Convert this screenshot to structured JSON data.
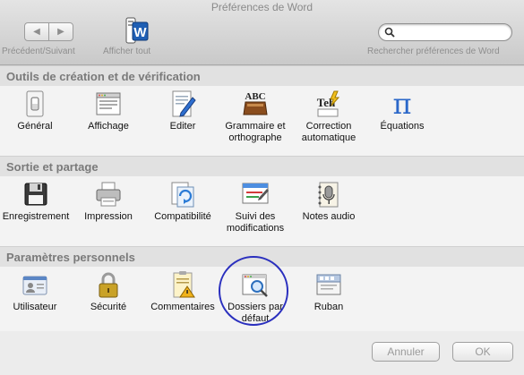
{
  "window": {
    "title": "Préférences de Word"
  },
  "toolbar": {
    "nav_label": "Précédent/Suivant",
    "show_all_label": "Afficher tout",
    "search_placeholder": "Rechercher préférences de Word"
  },
  "sections": [
    {
      "title": "Outils de création et de vérification",
      "items": [
        {
          "label": "Général",
          "icon": "light-switch-icon"
        },
        {
          "label": "Affichage",
          "icon": "window-view-icon"
        },
        {
          "label": "Editer",
          "icon": "document-pencil-icon"
        },
        {
          "label": "Grammaire et orthographe",
          "icon": "abc-book-icon"
        },
        {
          "label": "Correction automatique",
          "icon": "autocorrect-icon"
        },
        {
          "label": "Équations",
          "icon": "pi-icon"
        }
      ]
    },
    {
      "title": "Sortie et partage",
      "items": [
        {
          "label": "Enregistrement",
          "icon": "floppy-disk-icon"
        },
        {
          "label": "Impression",
          "icon": "printer-icon"
        },
        {
          "label": "Compatibilité",
          "icon": "compatibility-icon"
        },
        {
          "label": "Suivi des modifications",
          "icon": "track-changes-icon"
        },
        {
          "label": "Notes audio",
          "icon": "microphone-notebook-icon"
        }
      ]
    },
    {
      "title": "Paramètres personnels",
      "items": [
        {
          "label": "Utilisateur",
          "icon": "id-card-icon"
        },
        {
          "label": "Sécurité",
          "icon": "padlock-icon"
        },
        {
          "label": "Commentaires",
          "icon": "comment-warning-icon"
        },
        {
          "label": "Dossiers par défaut",
          "icon": "folder-magnifier-icon"
        },
        {
          "label": "Ruban",
          "icon": "ribbon-icon"
        }
      ]
    }
  ],
  "buttons": {
    "cancel": "Annuler",
    "ok": "OK"
  },
  "colors": {
    "highlight_circle": "#2a2fbe"
  }
}
